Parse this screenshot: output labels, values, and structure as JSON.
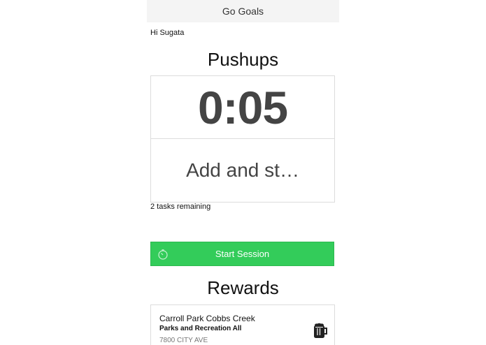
{
  "navbar": {
    "title": "Go Goals"
  },
  "greeting": "Hi Sugata",
  "goal": {
    "title": "Pushups",
    "timer": "0:05",
    "task_placeholder": "Add and st…",
    "remaining": "2 tasks remaining"
  },
  "session": {
    "start_label": "Start Session",
    "icon": "timer-icon"
  },
  "rewards": {
    "title": "Rewards",
    "items": [
      {
        "name": "Carroll Park Cobbs Creek",
        "category": "Parks and Recreation All",
        "address": "7800 CITY AVE",
        "icon": "beer-mug-icon"
      }
    ]
  },
  "colors": {
    "accent_green": "#33cc5a",
    "navbar_bg": "#f4f4f4",
    "card_border": "#dcdcdc"
  }
}
